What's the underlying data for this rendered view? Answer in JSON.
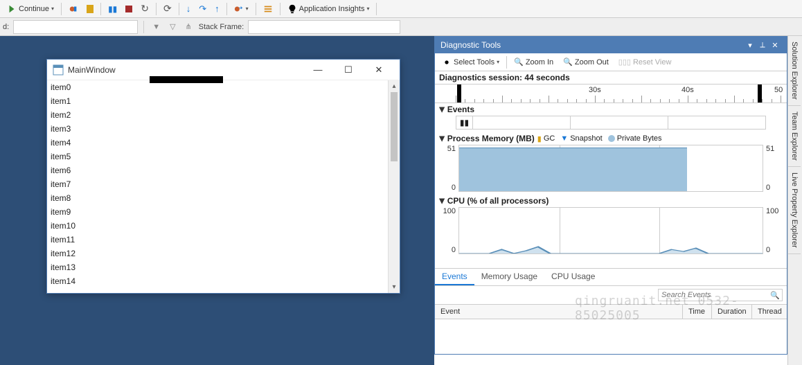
{
  "toolbar": {
    "continue": "Continue",
    "app_insights": "Application Insights"
  },
  "secondbar": {
    "d_label": "d:",
    "stack_label": "Stack Frame:"
  },
  "mainwindow": {
    "title": "MainWindow",
    "items": [
      "item0",
      "item1",
      "item2",
      "item3",
      "item4",
      "item5",
      "item6",
      "item7",
      "item8",
      "item9",
      "item10",
      "item11",
      "item12",
      "item13",
      "item14"
    ]
  },
  "diag": {
    "title": "Diagnostic Tools",
    "select_tools": "Select Tools",
    "zoom_in": "Zoom In",
    "zoom_out": "Zoom Out",
    "reset_view": "Reset View",
    "session": "Diagnostics session: 44 seconds",
    "timeline_ticks": [
      "30s",
      "40s",
      "50"
    ],
    "events_label": "Events",
    "mem_label": "Process Memory (MB)",
    "legend_gc": "GC",
    "legend_snap": "Snapshot",
    "legend_pb": "Private Bytes",
    "cpu_label": "CPU (% of all processors)",
    "tabs": [
      "Events",
      "Memory Usage",
      "CPU Usage"
    ],
    "search_ph": "Search Events",
    "cols": {
      "event": "Event",
      "time": "Time",
      "duration": "Duration",
      "thread": "Thread"
    }
  },
  "side": [
    "Solution Explorer",
    "Team Explorer",
    "Live Property Explorer"
  ],
  "watermark": "qingruanit.net 0532-85025005",
  "chart_data": [
    {
      "type": "area",
      "title": "Process Memory (MB)",
      "ylabel": "MB",
      "ylim": [
        0,
        51
      ],
      "x_range_seconds": [
        24,
        52
      ],
      "series": [
        {
          "name": "Private Bytes",
          "values": [
            {
              "t": 24,
              "v": 50
            },
            {
              "t": 44,
              "v": 50
            },
            {
              "t": 44.5,
              "v": 0
            },
            {
              "t": 52,
              "v": 0
            }
          ]
        }
      ],
      "right_axis_values": [
        51,
        0
      ]
    },
    {
      "type": "line",
      "title": "CPU (% of all processors)",
      "ylabel": "%",
      "ylim": [
        0,
        100
      ],
      "x_range_seconds": [
        24,
        52
      ],
      "series": [
        {
          "name": "CPU",
          "values": [
            {
              "t": 24,
              "v": 0
            },
            {
              "t": 27,
              "v": 0
            },
            {
              "t": 28,
              "v": 6
            },
            {
              "t": 29,
              "v": 0
            },
            {
              "t": 30,
              "v": 4
            },
            {
              "t": 31,
              "v": 10
            },
            {
              "t": 32,
              "v": 0
            },
            {
              "t": 42,
              "v": 0
            },
            {
              "t": 43,
              "v": 6
            },
            {
              "t": 44,
              "v": 3
            },
            {
              "t": 45,
              "v": 8
            },
            {
              "t": 46,
              "v": 0
            },
            {
              "t": 52,
              "v": 0
            }
          ]
        }
      ],
      "right_axis_values": [
        100,
        0
      ]
    }
  ]
}
